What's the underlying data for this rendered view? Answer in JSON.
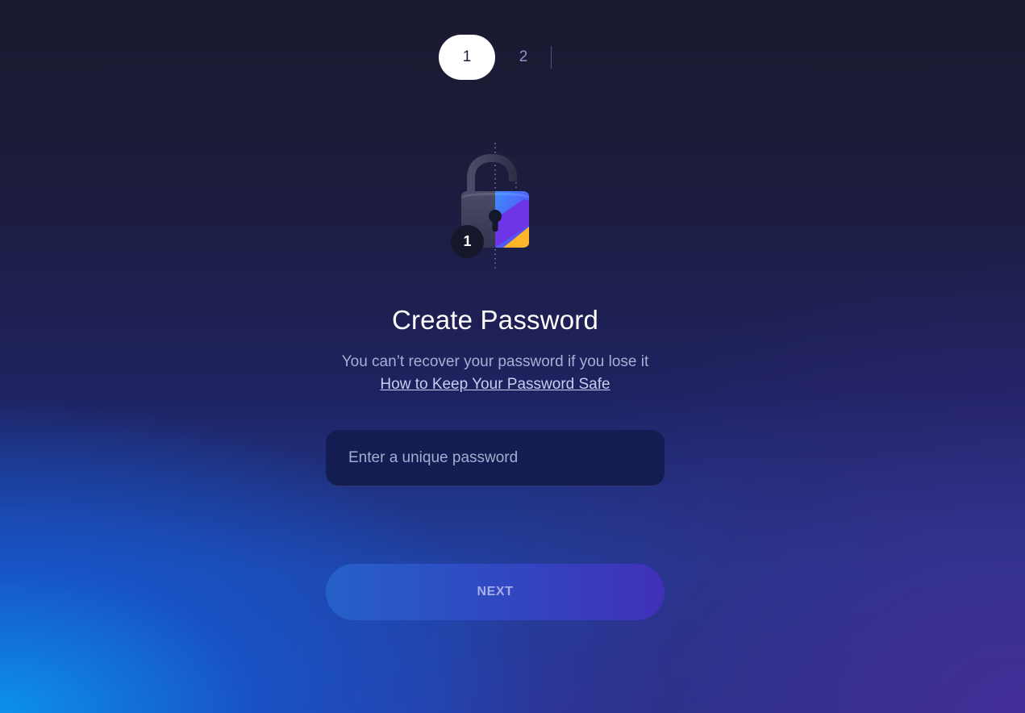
{
  "stepper": {
    "steps": [
      {
        "label": "1",
        "active": true
      },
      {
        "label": "2",
        "active": false
      }
    ]
  },
  "illustration": {
    "icon": "padlock-icon",
    "badge": "1"
  },
  "form": {
    "title": "Create Password",
    "subtitle": "You can’t recover your password if you lose it",
    "help_link": "How to Keep Your Password Safe",
    "password_placeholder": "Enter a unique password",
    "password_value": "",
    "next_label": "NEXT"
  },
  "colors": {
    "accent_blue": "#2560c8",
    "accent_purple": "#4030b8",
    "lock_yellow": "#ffb52a",
    "lock_blue": "#3f8cff"
  }
}
